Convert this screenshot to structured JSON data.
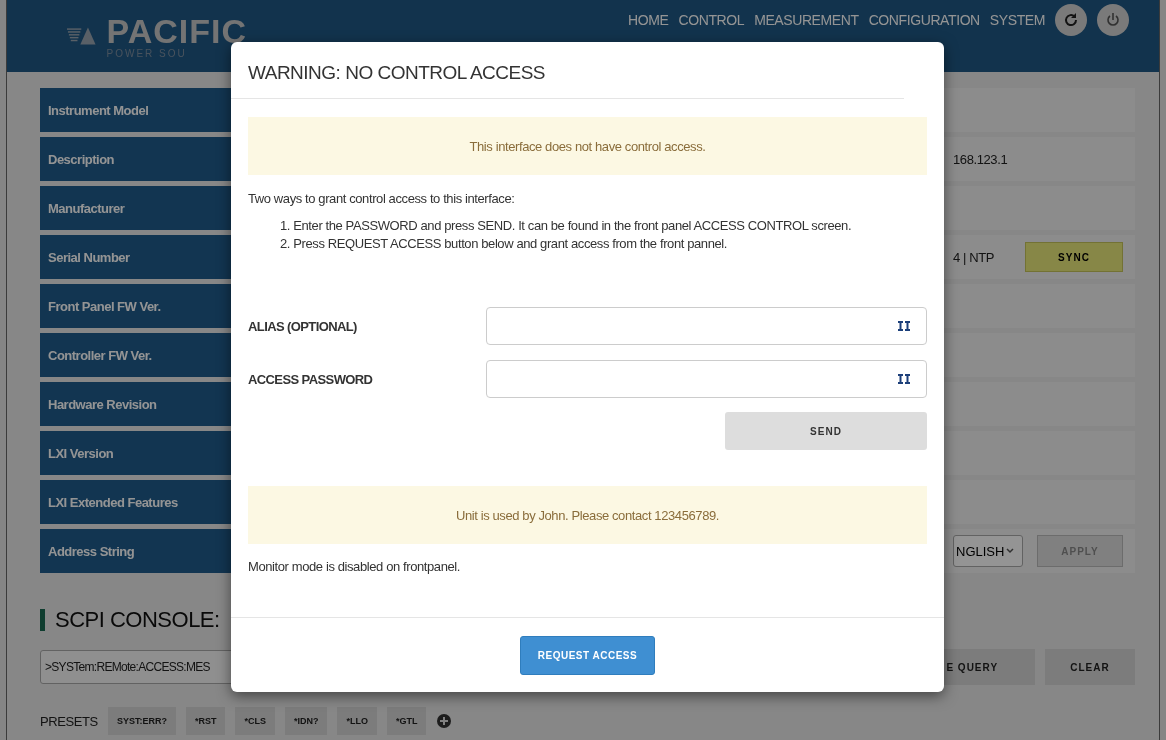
{
  "header": {
    "logo": {
      "name": "PACIFIC",
      "tagline": "POWER SOU"
    },
    "nav": [
      {
        "label": "HOME"
      },
      {
        "label": "CONTROL"
      },
      {
        "label": "MEASUREMENT"
      },
      {
        "label": "CONFIGURATION"
      },
      {
        "label": "SYSTEM"
      }
    ]
  },
  "info_rows": [
    {
      "label": "Instrument Model",
      "kind": "empty"
    },
    {
      "label": "Description",
      "kind": "text",
      "value": "168.123.1"
    },
    {
      "label": "Manufacturer",
      "kind": "empty"
    },
    {
      "label": "Serial Number",
      "kind": "text_button",
      "value": "4 | NTP",
      "button": "SYNC"
    },
    {
      "label": "Front Panel FW Ver.",
      "kind": "empty"
    },
    {
      "label": "Controller FW Ver.",
      "kind": "empty"
    },
    {
      "label": "Hardware Revision",
      "kind": "empty"
    },
    {
      "label": "LXI Version",
      "kind": "empty"
    },
    {
      "label": "LXI Extended Features",
      "kind": "empty"
    },
    {
      "label": "Address String",
      "kind": "select_button",
      "value": "NGLISH",
      "button": "APPLY"
    }
  ],
  "scpi_console": {
    "title": "SCPI CONSOLE:",
    "command": ">SYSTem:REMote:ACCESS:MES",
    "buttons": [
      "E QUERY",
      "CLEAR"
    ],
    "presets_label": "PRESETS",
    "presets": [
      "SYST:ERR?",
      "*RST",
      "*CLS",
      "*IDN?",
      "*LLO",
      "*GTL"
    ]
  },
  "modal": {
    "title": "WARNING: NO CONTROL ACCESS",
    "alert": "This interface does not have control access.",
    "intro": "Two ways to grant control access to this interface:",
    "steps": [
      "1. Enter the PASSWORD and press SEND. It can be found in the front panel ACCESS CONTROL screen.",
      "2. Press REQUEST ACCESS button below and grant access from the front pannel."
    ],
    "fields": [
      {
        "label": "ALIAS (OPTIONAL)"
      },
      {
        "label": "ACCESS PASSWORD"
      }
    ],
    "send_button": "SEND",
    "user_alert": "Unit is used by John. Please contact 123456789.",
    "note": "Monitor mode is disabled on frontpanel.",
    "request_button": "REQUEST ACCESS"
  }
}
